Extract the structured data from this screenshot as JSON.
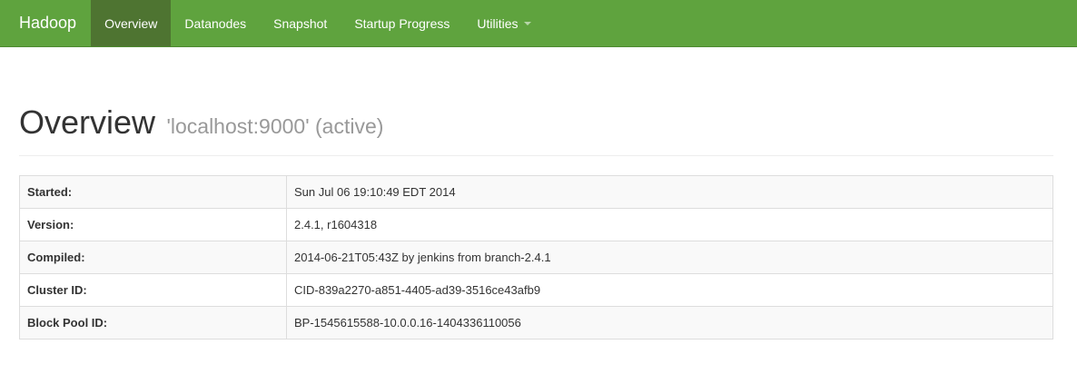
{
  "navbar": {
    "brand": "Hadoop",
    "items": [
      {
        "label": "Overview",
        "active": true
      },
      {
        "label": "Datanodes",
        "active": false
      },
      {
        "label": "Snapshot",
        "active": false
      },
      {
        "label": "Startup Progress",
        "active": false
      },
      {
        "label": "Utilities",
        "active": false,
        "dropdown": true
      }
    ],
    "color": "#5fa33e",
    "active_color": "#4e7431"
  },
  "header": {
    "title": "Overview",
    "subtitle": "'localhost:9000' (active)"
  },
  "info_table": {
    "rows": [
      {
        "key": "Started:",
        "value": "Sun Jul 06 19:10:49 EDT 2014"
      },
      {
        "key": "Version:",
        "value": "2.4.1, r1604318"
      },
      {
        "key": "Compiled:",
        "value": "2014-06-21T05:43Z by jenkins from branch-2.4.1"
      },
      {
        "key": "Cluster ID:",
        "value": "CID-839a2270-a851-4405-ad39-3516ce43afb9"
      },
      {
        "key": "Block Pool ID:",
        "value": "BP-1545615588-10.0.0.16-1404336110056"
      }
    ]
  }
}
